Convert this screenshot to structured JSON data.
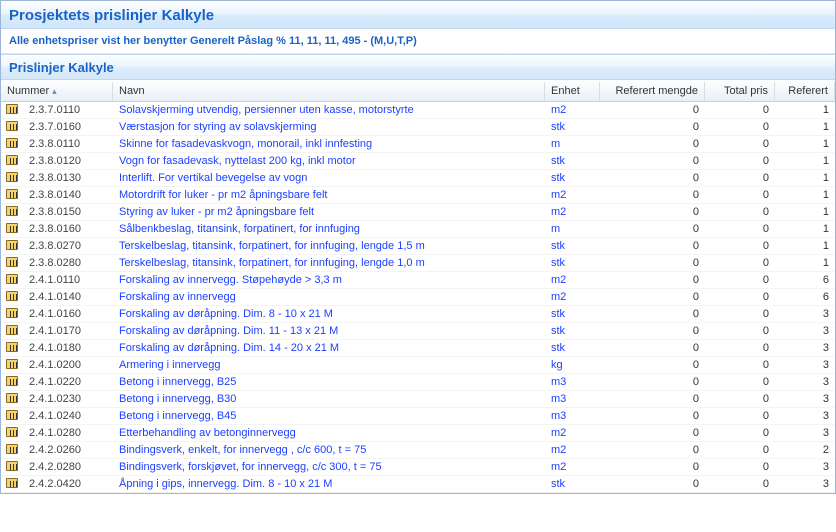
{
  "header": {
    "title": "Prosjektets prislinjer Kalkyle",
    "subtitle": "Alle enhetspriser vist her benytter Generelt Påslag % 11, 11, 11, 495  -  (M,U,T,P)"
  },
  "section": {
    "title": "Prislinjer Kalkyle"
  },
  "columns": {
    "nummer": "Nummer",
    "navn": "Navn",
    "enhet": "Enhet",
    "referert_mengde": "Referert mengde",
    "total_pris": "Total pris",
    "referert": "Referert"
  },
  "rows": [
    {
      "num": "2.3.7.0110",
      "name": "Solavskjerming utvendig, persienner uten kasse, motorstyrte",
      "unit": "m2",
      "qty": 0,
      "price": 0,
      "ref": 1
    },
    {
      "num": "2.3.7.0160",
      "name": "Værstasjon for styring av solavskjerming",
      "unit": "stk",
      "qty": 0,
      "price": 0,
      "ref": 1
    },
    {
      "num": "2.3.8.0110",
      "name": "Skinne for fasadevaskvogn, monorail,  inkl innfesting",
      "unit": "m",
      "qty": 0,
      "price": 0,
      "ref": 1
    },
    {
      "num": "2.3.8.0120",
      "name": "Vogn for fasadevask, nyttelast 200 kg, inkl motor",
      "unit": "stk",
      "qty": 0,
      "price": 0,
      "ref": 1
    },
    {
      "num": "2.3.8.0130",
      "name": "Interlift. For vertikal bevegelse av vogn",
      "unit": "stk",
      "qty": 0,
      "price": 0,
      "ref": 1
    },
    {
      "num": "2.3.8.0140",
      "name": "Motordrift for luker - pr m2 åpningsbare felt",
      "unit": "m2",
      "qty": 0,
      "price": 0,
      "ref": 1
    },
    {
      "num": "2.3.8.0150",
      "name": "Styring av luker - pr m2 åpningsbare felt",
      "unit": "m2",
      "qty": 0,
      "price": 0,
      "ref": 1
    },
    {
      "num": "2.3.8.0160",
      "name": "Sålbenkbeslag, titansink, forpatinert, for innfuging",
      "unit": "m",
      "qty": 0,
      "price": 0,
      "ref": 1
    },
    {
      "num": "2.3.8.0270",
      "name": "Terskelbeslag, titansink, forpatinert, for innfuging, lengde 1,5 m",
      "unit": "stk",
      "qty": 0,
      "price": 0,
      "ref": 1
    },
    {
      "num": "2.3.8.0280",
      "name": "Terskelbeslag, titansink, forpatinert, for innfuging, lengde 1,0 m",
      "unit": "stk",
      "qty": 0,
      "price": 0,
      "ref": 1
    },
    {
      "num": "2.4.1.0110",
      "name": "Forskaling av innervegg. Støpehøyde > 3,3 m",
      "unit": "m2",
      "qty": 0,
      "price": 0,
      "ref": 6
    },
    {
      "num": "2.4.1.0140",
      "name": "Forskaling av innervegg",
      "unit": "m2",
      "qty": 0,
      "price": 0,
      "ref": 6
    },
    {
      "num": "2.4.1.0160",
      "name": "Forskaling av døråpning. Dim. 8 - 10 x 21 M",
      "unit": "stk",
      "qty": 0,
      "price": 0,
      "ref": 3
    },
    {
      "num": "2.4.1.0170",
      "name": "Forskaling av døråpning. Dim. 11 - 13 x 21 M",
      "unit": "stk",
      "qty": 0,
      "price": 0,
      "ref": 3
    },
    {
      "num": "2.4.1.0180",
      "name": "Forskaling av døråpning. Dim. 14 - 20 x 21 M",
      "unit": "stk",
      "qty": 0,
      "price": 0,
      "ref": 3
    },
    {
      "num": "2.4.1.0200",
      "name": "Armering i innervegg",
      "unit": "kg",
      "qty": 0,
      "price": 0,
      "ref": 3
    },
    {
      "num": "2.4.1.0220",
      "name": "Betong i innervegg, B25",
      "unit": "m3",
      "qty": 0,
      "price": 0,
      "ref": 3
    },
    {
      "num": "2.4.1.0230",
      "name": "Betong i innervegg, B30",
      "unit": "m3",
      "qty": 0,
      "price": 0,
      "ref": 3
    },
    {
      "num": "2.4.1.0240",
      "name": "Betong i innervegg, B45",
      "unit": "m3",
      "qty": 0,
      "price": 0,
      "ref": 3
    },
    {
      "num": "2.4.1.0280",
      "name": "Etterbehandling av betonginnervegg",
      "unit": "m2",
      "qty": 0,
      "price": 0,
      "ref": 3
    },
    {
      "num": "2.4.2.0260",
      "name": "Bindingsverk, enkelt, for innervegg , c/c 600, t = 75",
      "unit": "m2",
      "qty": 0,
      "price": 0,
      "ref": 2
    },
    {
      "num": "2.4.2.0280",
      "name": "Bindingsverk, forskjøvet, for innervegg, c/c 300, t = 75",
      "unit": "m2",
      "qty": 0,
      "price": 0,
      "ref": 3
    },
    {
      "num": "2.4.2.0420",
      "name": "Åpning i gips, innervegg. Dim. 8 - 10 x 21 M",
      "unit": "stk",
      "qty": 0,
      "price": 0,
      "ref": 3
    }
  ]
}
